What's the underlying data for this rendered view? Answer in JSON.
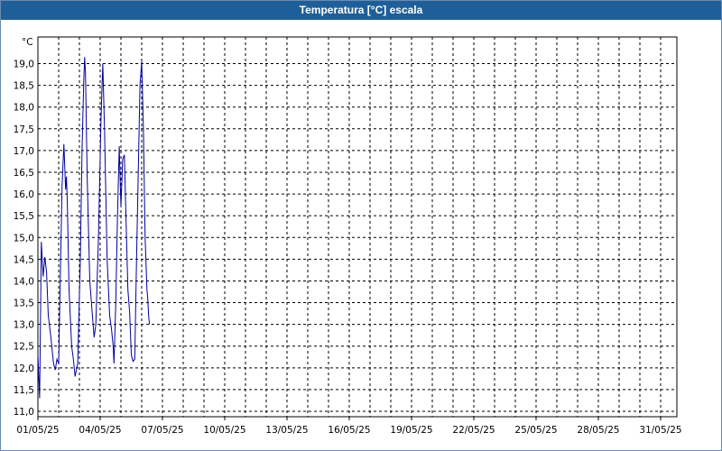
{
  "window": {
    "title": "Temperatura [°C] escala"
  },
  "chart_data": {
    "type": "line",
    "title": "Temperatura [°C] escala",
    "ylabel": "°C",
    "ylim": [
      11.0,
      19.4
    ],
    "y_ticks": [
      "11,0",
      "11,5",
      "12,0",
      "12,5",
      "13,0",
      "13,5",
      "14,0",
      "14,5",
      "15,0",
      "15,5",
      "16,0",
      "16,5",
      "17,0",
      "17,5",
      "18,0",
      "18,5",
      "19,0"
    ],
    "xlim": [
      "2025-05-01",
      "2025-06-01"
    ],
    "x_ticks": [
      {
        "date": "2025-05-01",
        "label": "01/05/25"
      },
      {
        "date": "2025-05-04",
        "label": "04/05/25"
      },
      {
        "date": "2025-05-07",
        "label": "07/05/25"
      },
      {
        "date": "2025-05-10",
        "label": "10/05/25"
      },
      {
        "date": "2025-05-13",
        "label": "13/05/25"
      },
      {
        "date": "2025-05-16",
        "label": "16/05/25"
      },
      {
        "date": "2025-05-19",
        "label": "19/05/25"
      },
      {
        "date": "2025-05-22",
        "label": "22/05/25"
      },
      {
        "date": "2025-05-25",
        "label": "25/05/25"
      },
      {
        "date": "2025-05-28",
        "label": "28/05/25"
      },
      {
        "date": "2025-05-31",
        "label": "31/05/25"
      }
    ],
    "grid": true,
    "line_color": "#0000a0",
    "series": [
      {
        "points": [
          [
            "2025-05-01 00:00",
            12.3
          ],
          [
            "2025-05-01 02:00",
            11.3
          ],
          [
            "2025-05-01 04:00",
            14.9
          ],
          [
            "2025-05-01 06:00",
            14.1
          ],
          [
            "2025-05-01 08:00",
            14.55
          ],
          [
            "2025-05-01 10:00",
            14.2
          ],
          [
            "2025-05-01 12:00",
            13.2
          ],
          [
            "2025-05-01 15:00",
            12.7
          ],
          [
            "2025-05-01 18:00",
            12.1
          ],
          [
            "2025-05-01 20:00",
            11.95
          ],
          [
            "2025-05-01 22:00",
            12.2
          ],
          [
            "2025-05-02 00:00",
            12.1
          ],
          [
            "2025-05-02 02:00",
            14.2
          ],
          [
            "2025-05-02 04:00",
            16.2
          ],
          [
            "2025-05-02 06:00",
            17.15
          ],
          [
            "2025-05-02 08:00",
            16.1
          ],
          [
            "2025-05-02 09:00",
            16.4
          ],
          [
            "2025-05-02 10:00",
            15.8
          ],
          [
            "2025-05-02 12:00",
            13.8
          ],
          [
            "2025-05-02 15:00",
            12.5
          ],
          [
            "2025-05-02 17:00",
            12.2
          ],
          [
            "2025-05-02 19:00",
            11.8
          ],
          [
            "2025-05-02 22:00",
            12.1
          ],
          [
            "2025-05-03 01:00",
            14.5
          ],
          [
            "2025-05-03 03:00",
            17.0
          ],
          [
            "2025-05-03 05:00",
            18.6
          ],
          [
            "2025-05-03 06:00",
            19.15
          ],
          [
            "2025-05-03 07:00",
            18.8
          ],
          [
            "2025-05-03 09:00",
            16.4
          ],
          [
            "2025-05-03 12:00",
            14.0
          ],
          [
            "2025-05-03 15:00",
            13.2
          ],
          [
            "2025-05-03 17:00",
            12.7
          ],
          [
            "2025-05-03 19:00",
            13.0
          ],
          [
            "2025-05-03 22:00",
            15.0
          ],
          [
            "2025-05-04 01:00",
            17.8
          ],
          [
            "2025-05-04 03:00",
            19.0
          ],
          [
            "2025-05-04 05:00",
            17.5
          ],
          [
            "2025-05-04 08:00",
            14.5
          ],
          [
            "2025-05-04 11:00",
            13.2
          ],
          [
            "2025-05-04 13:00",
            12.9
          ],
          [
            "2025-05-04 15:00",
            12.5
          ],
          [
            "2025-05-04 16:00",
            12.1
          ],
          [
            "2025-05-04 18:00",
            13.5
          ],
          [
            "2025-05-04 20:00",
            15.5
          ],
          [
            "2025-05-04 22:00",
            17.1
          ],
          [
            "2025-05-05 00:00",
            15.7
          ],
          [
            "2025-05-05 02:00",
            16.8
          ],
          [
            "2025-05-05 04:00",
            16.9
          ],
          [
            "2025-05-05 06:00",
            15.3
          ],
          [
            "2025-05-05 08:00",
            13.8
          ],
          [
            "2025-05-05 10:00",
            13.3
          ],
          [
            "2025-05-05 12:00",
            12.3
          ],
          [
            "2025-05-05 14:00",
            12.15
          ],
          [
            "2025-05-05 16:00",
            12.2
          ],
          [
            "2025-05-05 18:00",
            14.5
          ],
          [
            "2025-05-05 20:00",
            16.5
          ],
          [
            "2025-05-05 22:00",
            18.5
          ],
          [
            "2025-05-06 00:00",
            19.05
          ],
          [
            "2025-05-06 02:00",
            17.5
          ],
          [
            "2025-05-06 04:00",
            15.0
          ],
          [
            "2025-05-06 06:00",
            13.8
          ],
          [
            "2025-05-06 07:00",
            13.6
          ],
          [
            "2025-05-06 08:00",
            13.2
          ],
          [
            "2025-05-06 09:00",
            13.0
          ]
        ]
      }
    ]
  }
}
